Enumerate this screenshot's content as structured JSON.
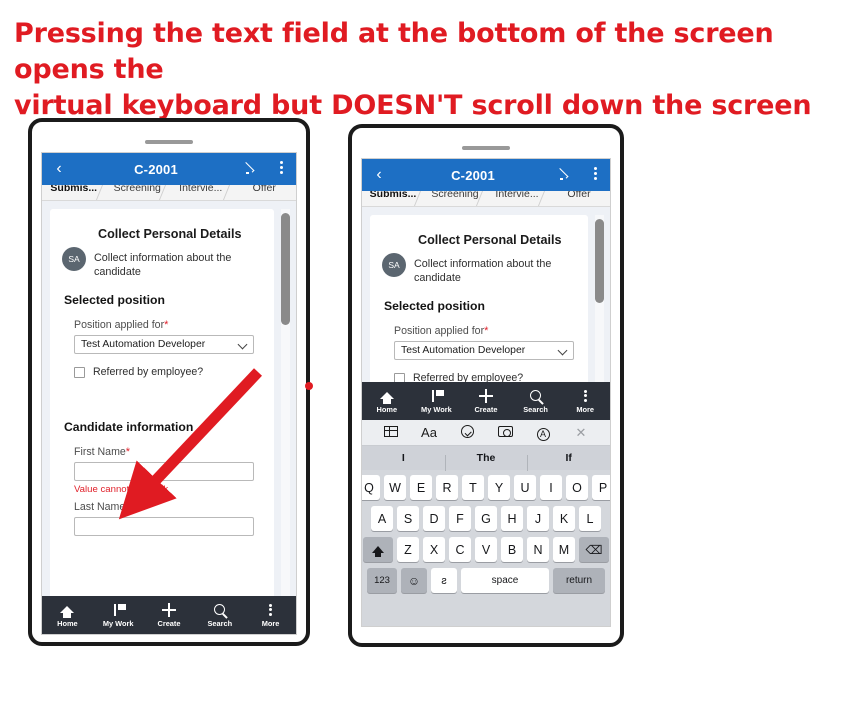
{
  "annotation": {
    "line1": "Pressing the text field at the bottom of the screen opens the",
    "line2": "virtual keyboard but DOESN'T scroll down the screen",
    "color": "#e01b22"
  },
  "app": {
    "header": {
      "back_icon": "chevron-left-icon",
      "title": "C-2001",
      "edit_icon": "pencil-icon",
      "menu_icon": "kebab-menu-icon",
      "background": "#1d6fc4"
    },
    "tabs": [
      {
        "label": "Submis...",
        "active": true
      },
      {
        "label": "Screening",
        "active": false
      },
      {
        "label": "Intervie...",
        "active": false
      },
      {
        "label": "Offer",
        "active": false
      }
    ],
    "card": {
      "heading": "Collect Personal Details",
      "avatar_initials": "SA",
      "description": "Collect information about the candidate",
      "section_position": "Selected position",
      "position_label": "Position applied for",
      "position_required": "*",
      "position_value": "Test Automation Developer",
      "referred_label": "Referred by employee?",
      "section_candidate": "Candidate information",
      "first_name_label": "First Name",
      "first_name_required": "*",
      "first_name_value": "",
      "first_name_error": "Value cannot be blank",
      "last_name_label": "Last Name",
      "last_name_required": "*",
      "last_name_value": ""
    },
    "bottom_nav": [
      {
        "label": "Home",
        "icon": "home-icon"
      },
      {
        "label": "My Work",
        "icon": "flag-icon"
      },
      {
        "label": "Create",
        "icon": "plus-icon"
      },
      {
        "label": "Search",
        "icon": "search-icon"
      },
      {
        "label": "More",
        "icon": "kebab-menu-icon"
      }
    ]
  },
  "keyboard": {
    "toolbar_icons": [
      "table-icon",
      "text-format-icon",
      "checkmark-circle-icon",
      "camera-icon",
      "annotate-icon",
      "close-icon"
    ],
    "toolbar_aa": "Aa",
    "toolbar_annot": "A",
    "toolbar_close": "✕",
    "suggestions": [
      "I",
      "The",
      "If"
    ],
    "row1": [
      "Q",
      "W",
      "E",
      "R",
      "T",
      "Y",
      "U",
      "I",
      "O",
      "P"
    ],
    "row2": [
      "A",
      "S",
      "D",
      "F",
      "G",
      "H",
      "J",
      "K",
      "L"
    ],
    "row3": [
      "Z",
      "X",
      "C",
      "V",
      "B",
      "N",
      "M"
    ],
    "shift_icon": "shift-icon",
    "backspace_icon": "backspace-icon",
    "backspace_glyph": "⌫",
    "numeric_key": "123",
    "emoji_key": "☺",
    "mic_key": "ƨ",
    "space_key": "space",
    "return_key": "return"
  }
}
